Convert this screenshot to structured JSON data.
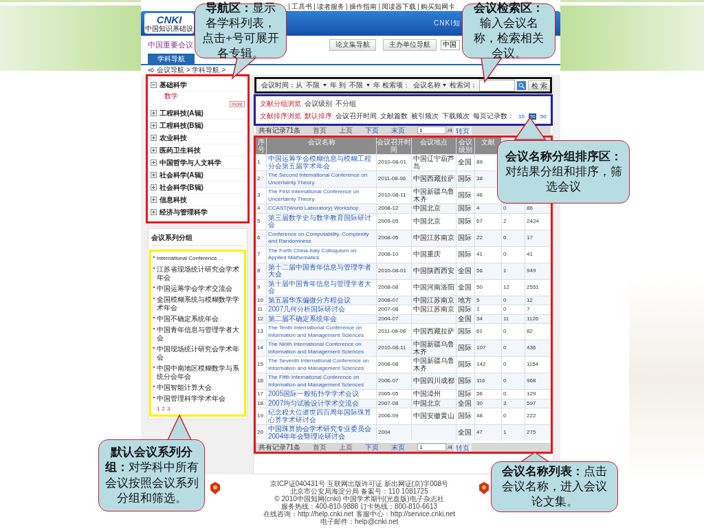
{
  "slide": {
    "callouts": [
      {
        "text": "**导航区：**显示各学科列表，点击+号可展开各专辑。"
      },
      {
        "text": "**会议检索区：**输入会议名称，检索相关会议。"
      },
      {
        "text": "**会议名称分组排序区：**对结果分组和排序，筛选会议"
      },
      {
        "text": "**默认会议系列分组：**对学科中所有会议按照会议系列分组和筛选。"
      },
      {
        "text": "**会议名称列表：**点击会议名称，进入会议论文集。"
      }
    ]
  },
  "site": {
    "top_links": [
      "工具书",
      "读者服务",
      "操作指南",
      "阅读器下载",
      "购买知网卡"
    ],
    "logo": "CNKI",
    "logo_subtitle": "中国知识基础设",
    "banner_text": "CNKI知",
    "title": "中国重要会议",
    "nav_buttons": [
      "论文集导航",
      "主办单位导航"
    ],
    "search_value": "中国",
    "tabs": [
      {
        "label": "学科导航",
        "selected": true
      }
    ],
    "breadcrumb": "会议导航 > 学科导航 >"
  },
  "sidebar": {
    "subjects": [
      {
        "label": "基础科学",
        "expanded": true,
        "children": [
          {
            "label": "数学"
          }
        ],
        "more": "more"
      },
      {
        "label": "工程科技(A辑)",
        "expanded": false
      },
      {
        "label": "工程科技(B辑)",
        "expanded": false
      },
      {
        "label": "农业科技",
        "expanded": false
      },
      {
        "label": "医药卫生科技",
        "expanded": false
      },
      {
        "label": "中国哲学与人文科学",
        "expanded": false
      },
      {
        "label": "社会科学(A辑)",
        "expanded": false
      },
      {
        "label": "社会科学(B辑)",
        "expanded": false
      },
      {
        "label": "信息科技",
        "expanded": false
      },
      {
        "label": "经济与管理科学",
        "expanded": false
      }
    ],
    "series": {
      "title": "会议系列分组",
      "items": [
        "International Conference ...",
        "江苏省现场统计研究会学术年会",
        "中国运筹学会学术交流会",
        "全国模糊系统与模糊数学学术年会",
        "中国不确定系统年会",
        "中国青年信息与管理学者大会",
        "中国现场统计研究会学术年会",
        "中国中南地区模糊数学与系统分会年会",
        "中国智能计算大会",
        "中国管理科学学术年会"
      ],
      "pages": [
        "1",
        "2",
        "3"
      ]
    }
  },
  "search": {
    "time_label": "会议时间：从",
    "from": "不限",
    "to_label": "年 到",
    "to": "不限",
    "year_label": "年",
    "field_label": "检索项：",
    "field": "会议名称",
    "term_label": "检索词：",
    "button": "检 索"
  },
  "grouping": {
    "label": "文献分组浏览",
    "options": [
      "会议级别",
      "不分组"
    ]
  },
  "sorting": {
    "label": "文献排序浏览",
    "options": [
      {
        "label": "默认排序",
        "selected": true
      },
      {
        "label": "会议召开时间",
        "selected": false
      },
      {
        "label": "文献篇数",
        "selected": false
      },
      {
        "label": "被引频次",
        "selected": false
      },
      {
        "label": "下载频次",
        "selected": false
      }
    ],
    "per_page_label": "每页记录数：",
    "per_page": [
      {
        "label": "10",
        "selected": false
      },
      {
        "label": "20",
        "selected": true
      },
      {
        "label": "50",
        "selected": false
      }
    ]
  },
  "pagers": [
    {
      "total": "共有记录71条",
      "links": [
        {
          "label": "首页",
          "disabled": true
        },
        {
          "label": "上页",
          "disabled": true
        },
        {
          "label": "下页",
          "disabled": false
        },
        {
          "label": "末页",
          "disabled": false
        }
      ],
      "page": "1",
      "of": "/4",
      "go": "转页"
    },
    {
      "total": "共有记录71条",
      "links": [
        {
          "label": "首页",
          "disabled": true
        },
        {
          "label": "上页",
          "disabled": true
        },
        {
          "label": "下页",
          "disabled": false
        },
        {
          "label": "末页",
          "disabled": false
        }
      ],
      "page": "1",
      "of": "/4",
      "go": "转页"
    }
  ],
  "table": {
    "columns": [
      "序号",
      "会议名称",
      "会议召开时间",
      "会议地点",
      "会议级别",
      "文献"
    ],
    "rows": [
      [
        "1",
        "中国运筹学会模糊信息与模糊工程分会第五届学术年会",
        "2010-08-01",
        "中国辽宁葫芦岛",
        "全国",
        "89"
      ],
      [
        "2",
        "The Second International Conference on Uncertainty Theory",
        "2011-08-06",
        "中国西藏拉萨",
        "国际",
        "38"
      ],
      [
        "3",
        "The First International Conference on Uncertainty Theory",
        "2010-08-11",
        "中国新疆乌鲁木齐",
        "国际",
        "46"
      ],
      [
        "4",
        "CCAST(World Laboratory) Workshop",
        "2008-12",
        "中国北京",
        "国际",
        "4",
        "0",
        "86"
      ],
      [
        "5",
        "第三届数学史与数学教育国际研讨会",
        "2009-05",
        "中国北京",
        "国际",
        "67",
        "2",
        "2424"
      ],
      [
        "6",
        "Conference on Computability, Complexity and Randomness",
        "2008-05",
        "中国江苏南京",
        "国际",
        "22",
        "0",
        "17"
      ],
      [
        "7",
        "The Forth China-Italy Colloquium on Applied Mathematics",
        "2008-10",
        "中国重庆",
        "国际",
        "41",
        "0",
        "41"
      ],
      [
        "8",
        "第十二届中国青年信息与管理学者大会",
        "2010-08-01",
        "中国陕西西安",
        "全国",
        "56",
        "1",
        "949"
      ],
      [
        "9",
        "第十届中国青年信息与管理学者大会",
        "2008-08",
        "中国河南洛阳",
        "全国",
        "50",
        "12",
        "2551"
      ],
      [
        "10",
        "第五届华东偏微分方程会议",
        "2008-07",
        "中国江苏南京",
        "地方",
        "5",
        "0",
        "12"
      ],
      [
        "11",
        "2007几何分析国际研讨会",
        "2007-08",
        "中国江苏南京",
        "国际",
        "1",
        "0",
        "7"
      ],
      [
        "12",
        "第二届不确定系统年会",
        "2004-07",
        null,
        "全国",
        "34",
        "11",
        "1126"
      ],
      [
        "13",
        "The Tenth International Conference on Information and Management Sciences",
        "2011-08-06",
        "中国西藏拉萨",
        "国际",
        "61",
        "0",
        "82"
      ],
      [
        "14",
        "The Ninth International Conference on Information and Management Sciences",
        "2010-08-11",
        "中国新疆乌鲁木齐",
        "国际",
        "107",
        "0",
        "436"
      ],
      [
        "15",
        "The Seventh International Conference on Information and Management Sciences",
        "2008-08",
        "中国新疆乌鲁木齐",
        "国际",
        "142",
        "0",
        "1154"
      ],
      [
        "16",
        "The Fifth International Conference on Information and Management Sciences",
        "2006-07",
        "中国四川成都",
        "国际",
        "116",
        "0",
        "968"
      ],
      [
        "17",
        "2005国际一般拓扑学学术会议",
        "2005-05",
        "中国漳州",
        "国际",
        "56",
        "0",
        "129"
      ],
      [
        "18",
        "2007均匀试验设计学术交流会",
        "2007-08",
        "中国北京",
        "全国",
        "30",
        "3",
        "597"
      ],
      [
        "19",
        "纪念程大位逝世四百周年国际珠算心算学术研讨会",
        "2006-09",
        "中国安徽黄山",
        "国际",
        "48",
        "0",
        "222"
      ],
      [
        "20",
        "中国珠算协会学术研究专业委员会2004年年会暨理论研讨会",
        "2004",
        null,
        "全国",
        "47",
        "1",
        "275"
      ]
    ]
  },
  "footer": {
    "lines": [
      [
        "京ICP证040431号 互联网出版许可证 新出网证(京)字008号"
      ],
      [
        "北京市公安局海淀分局 备案号：110 1081725"
      ],
      [
        "© 2010中国知网(cnki) 中国学术期刊(光盘版)电子杂志社"
      ],
      [
        "服务热线：400-810-9888 订卡热线：800-810-6613"
      ],
      [
        "在线咨询：http://help.cnki.net",
        "客服中心：http://service.cnki.net",
        "电子邮件：help@cnki.net"
      ]
    ]
  }
}
